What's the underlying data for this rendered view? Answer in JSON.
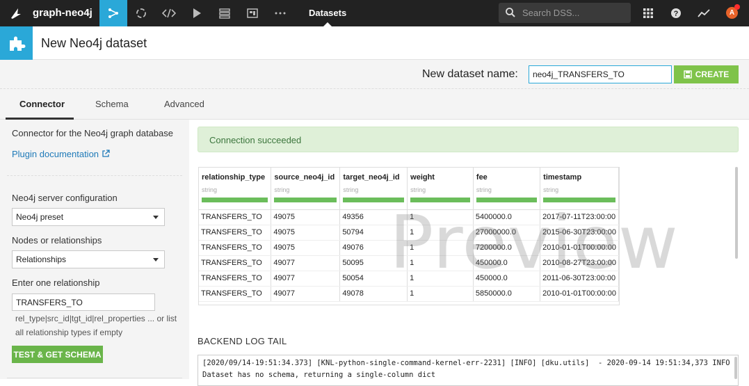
{
  "topnav": {
    "project_name": "graph-neo4j",
    "section_label": "Datasets",
    "search_placeholder": "Search DSS...",
    "avatar_initial": "A",
    "nav_icons": [
      "flow-icon",
      "jobs-icon",
      "code-icon",
      "run-icon",
      "deploy-icon",
      "dashboard-icon",
      "more-icon"
    ],
    "accent_color": "#2aa8d8"
  },
  "page": {
    "title": "New Neo4j dataset"
  },
  "namebar": {
    "label": "New dataset name:",
    "dataset_name": "neo4j_TRANSFERS_TO",
    "create_label": "CREATE"
  },
  "tabs": {
    "items": [
      {
        "label": "Connector",
        "active": true
      },
      {
        "label": "Schema",
        "active": false
      },
      {
        "label": "Advanced",
        "active": false
      }
    ]
  },
  "left": {
    "description": "Connector for the Neo4j graph database",
    "doc_link": "Plugin documentation",
    "server_config_label": "Neo4j server configuration",
    "server_config_value": "Neo4j preset",
    "nodes_rel_label": "Nodes or relationships",
    "nodes_rel_value": "Relationships",
    "relationship_label": "Enter one relationship",
    "relationship_value": "TRANSFERS_TO",
    "hint": "rel_type|src_id|tgt_id|rel_properties ... or list all relationship types if empty",
    "test_button": "TEST & GET SCHEMA"
  },
  "status": {
    "message": "Connection succeeded"
  },
  "preview": {
    "watermark": "Preview",
    "columns": [
      {
        "name": "relationship_type",
        "type": "string"
      },
      {
        "name": "source_neo4j_id",
        "type": "string"
      },
      {
        "name": "target_neo4j_id",
        "type": "string"
      },
      {
        "name": "weight",
        "type": "string"
      },
      {
        "name": "fee",
        "type": "string"
      },
      {
        "name": "timestamp",
        "type": "string"
      }
    ],
    "rows": [
      [
        "TRANSFERS_TO",
        "49075",
        "49356",
        "1",
        "5400000.0",
        "2017-07-11T23:00:00"
      ],
      [
        "TRANSFERS_TO",
        "49075",
        "50794",
        "1",
        "27000000.0",
        "2015-06-30T23:00:00"
      ],
      [
        "TRANSFERS_TO",
        "49075",
        "49076",
        "1",
        "7200000.0",
        "2010-01-01T00:00:00"
      ],
      [
        "TRANSFERS_TO",
        "49077",
        "50095",
        "1",
        "450000.0",
        "2010-08-27T23:00:00"
      ],
      [
        "TRANSFERS_TO",
        "49077",
        "50054",
        "1",
        "450000.0",
        "2011-06-30T23:00:00"
      ],
      [
        "TRANSFERS_TO",
        "49077",
        "49078",
        "1",
        "5850000.0",
        "2010-01-01T00:00:00"
      ]
    ]
  },
  "log": {
    "title": "BACKEND LOG TAIL",
    "lines": [
      "[2020/09/14-19:51:34.373] [KNL-python-single-command-kernel-err-2231] [INFO] [dku.utils]  - 2020-09-14 19:51:34,373 INFO",
      "Dataset has no schema, returning a single-column dict"
    ]
  }
}
